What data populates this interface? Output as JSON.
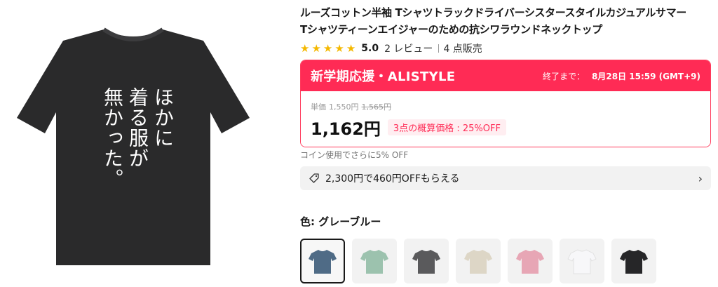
{
  "product": {
    "title_line1": "ルーズコットン半袖 Tシャツトラックドライバーシスタースタイルカジュアルサマー",
    "title_line2": "Tシャツティーンエイジャーのための抗シワラウンドネックトップ",
    "image_text": [
      "ほかに",
      "着る服が",
      "無かった。"
    ],
    "shirt_color": "#2a2a2b"
  },
  "rating": {
    "score": "5.0",
    "reviews": "2 レビュー",
    "sold": "4 点販売",
    "star_color": "#f5b800"
  },
  "promo": {
    "title": "新学期応援・ALISTYLE",
    "end_label": "終了まで：",
    "end_time": "8月28日 15:59 (GMT+9)",
    "accent": "#ff2b55",
    "unit_label": "単価",
    "unit_price": "1,550円",
    "old_price": "1,565円",
    "price": "1,162円",
    "discount_badge": "3点の概算価格 : 25%OFF"
  },
  "coin_note": "コイン使用でさらに5% OFF",
  "coupon": {
    "label": "2,300円で460円OFFもらえる",
    "icon": "tag-icon"
  },
  "color": {
    "label": "色: グレーブルー",
    "swatches": [
      {
        "name": "gray-blue",
        "hex": "#4f6b86",
        "selected": true
      },
      {
        "name": "mint",
        "hex": "#9cc2ae",
        "selected": false
      },
      {
        "name": "charcoal",
        "hex": "#5a5a5c",
        "selected": false
      },
      {
        "name": "beige",
        "hex": "#ddd6c6",
        "selected": false
      },
      {
        "name": "pink",
        "hex": "#e7a6b5",
        "selected": false
      },
      {
        "name": "white",
        "hex": "#f7f7f9",
        "selected": false
      },
      {
        "name": "black",
        "hex": "#262628",
        "selected": false
      }
    ]
  }
}
